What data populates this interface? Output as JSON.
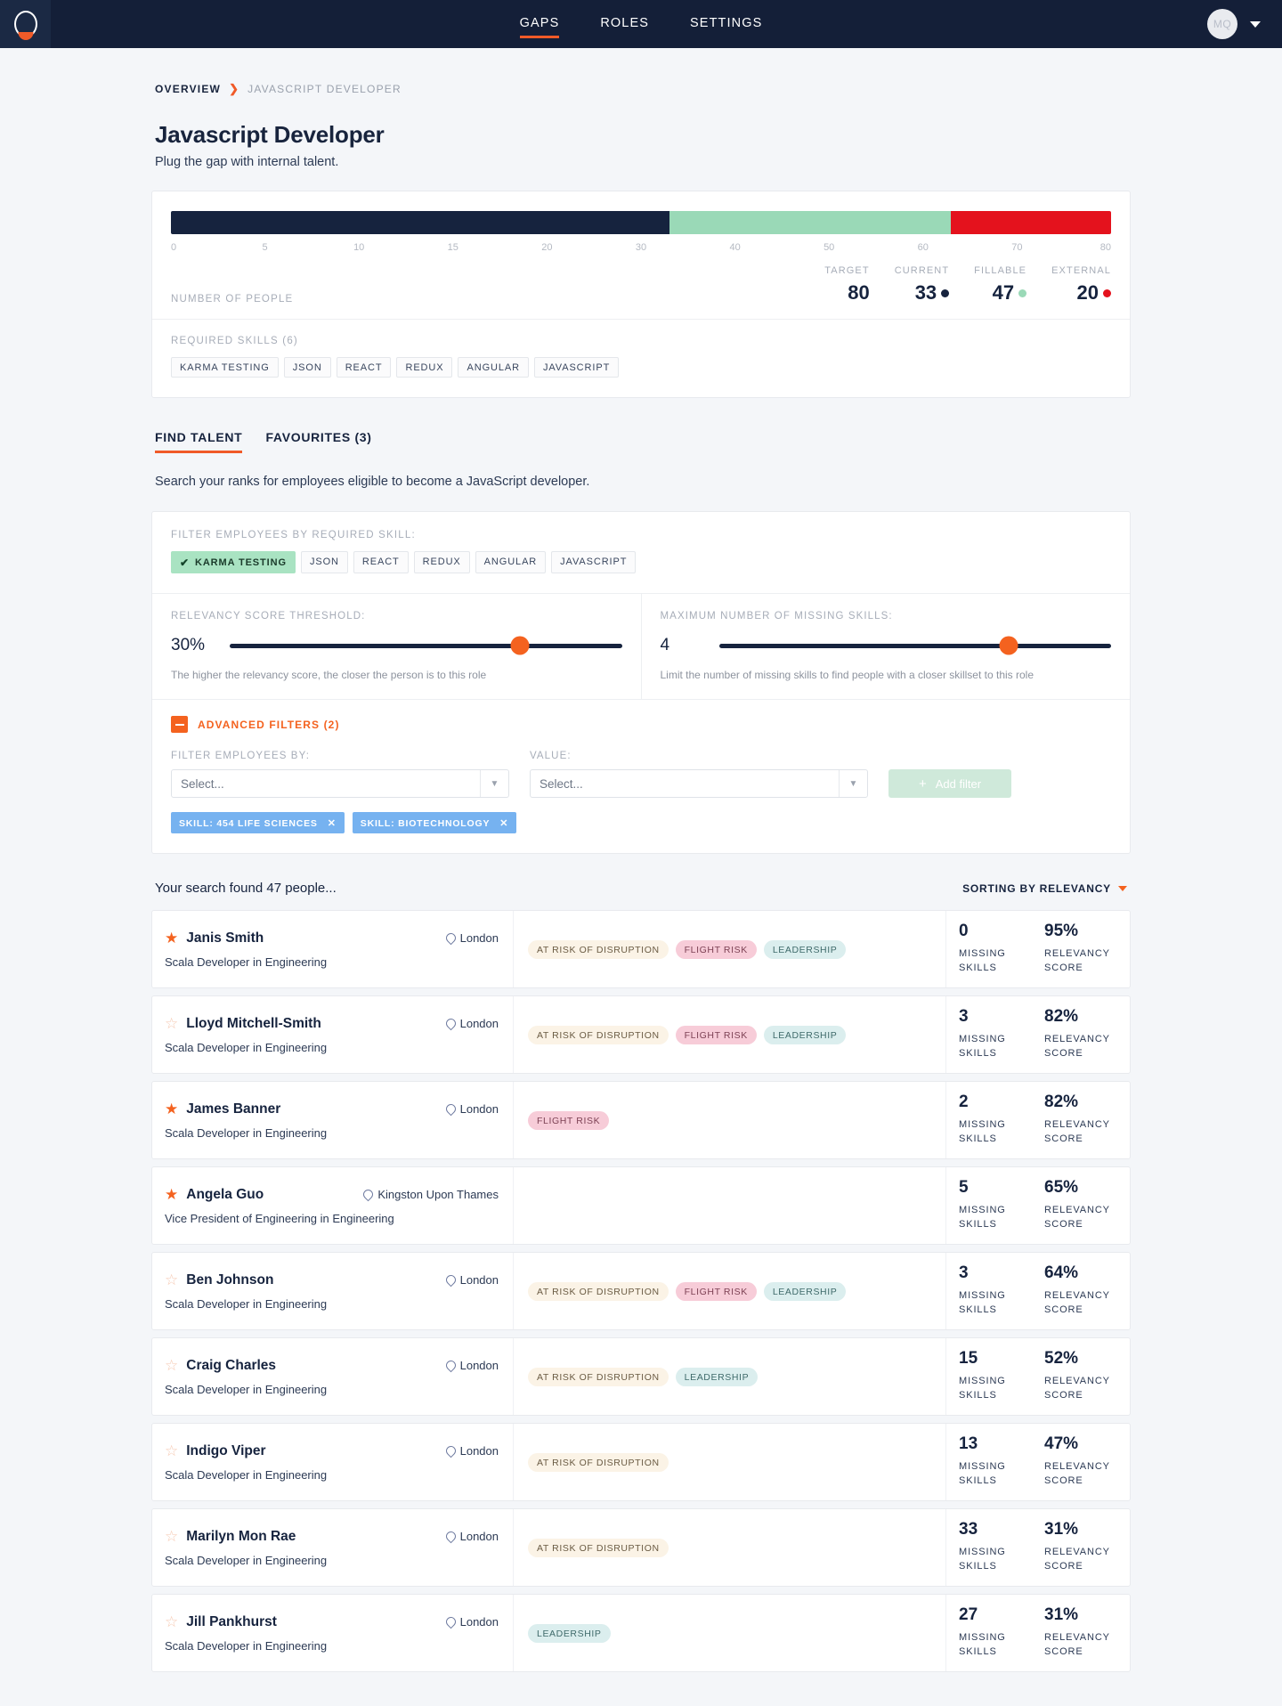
{
  "nav": {
    "logo": "logo-mark",
    "links": [
      {
        "label": "GAPS",
        "active": true
      },
      {
        "label": "ROLES",
        "active": false
      },
      {
        "label": "SETTINGS",
        "active": false
      }
    ],
    "avatar_initials": "MQ"
  },
  "breadcrumb": {
    "root": "OVERVIEW",
    "separator": "❯",
    "current": "JAVASCRIPT DEVELOPER"
  },
  "header": {
    "title": "Javascript Developer",
    "subtitle": "Plug the gap with internal talent."
  },
  "gauge": {
    "caption": "NUMBER OF PEOPLE",
    "ticks": [
      {
        "label": "0",
        "pos": 0
      },
      {
        "label": "5",
        "pos": 10
      },
      {
        "label": "10",
        "pos": 20
      },
      {
        "label": "15",
        "pos": 30
      },
      {
        "label": "20",
        "pos": 40
      },
      {
        "label": "30",
        "pos": 50
      },
      {
        "label": "40",
        "pos": 60
      },
      {
        "label": "50",
        "pos": 70
      },
      {
        "label": "60",
        "pos": 80
      },
      {
        "label": "70",
        "pos": 90
      },
      {
        "label": "80",
        "pos": 100
      }
    ],
    "segments": {
      "current_pct": 53,
      "fillable_pct": 30,
      "external_pct": 17
    },
    "stats": [
      {
        "label": "TARGET",
        "value": "80",
        "dot": "none"
      },
      {
        "label": "CURRENT",
        "value": "33",
        "dot": "current"
      },
      {
        "label": "FILLABLE",
        "value": "47",
        "dot": "fillable"
      },
      {
        "label": "EXTERNAL",
        "value": "20",
        "dot": "external"
      }
    ],
    "colors": {
      "current": "#16233e",
      "fillable": "#9ad9b7",
      "external": "#e4121d"
    }
  },
  "required_skills": {
    "caption": "REQUIRED SKILLS (6)",
    "items": [
      "KARMA TESTING",
      "JSON",
      "REACT",
      "REDUX",
      "ANGULAR",
      "JAVASCRIPT"
    ]
  },
  "tabs": [
    {
      "label": "FIND TALENT",
      "active": true
    },
    {
      "label": "FAVOURITES (3)",
      "active": false
    }
  ],
  "tab_description": "Search your ranks for employees eligible to become a JavaScript developer.",
  "filters": {
    "skill_caption": "FILTER EMPLOYEES BY REQUIRED SKILL:",
    "skill_chips": [
      {
        "label": "KARMA TESTING",
        "selected": true
      },
      {
        "label": "JSON",
        "selected": false
      },
      {
        "label": "REACT",
        "selected": false
      },
      {
        "label": "REDUX",
        "selected": false
      },
      {
        "label": "ANGULAR",
        "selected": false
      },
      {
        "label": "JAVASCRIPT",
        "selected": false
      }
    ],
    "relevancy": {
      "label": "RELEVANCY SCORE THRESHOLD:",
      "value": "30%",
      "thumb_pct": 74,
      "hint": "The higher the relevancy score, the closer the person is to this role"
    },
    "missing": {
      "label": "MAXIMUM NUMBER OF MISSING SKILLS:",
      "value": "4",
      "thumb_pct": 74,
      "hint": "Limit the number of missing skills to find people with a closer skillset to this role"
    },
    "advanced": {
      "title": "ADVANCED FILTERS (2)",
      "by_label": "FILTER EMPLOYEES BY:",
      "by_value": "Select...",
      "value_label": "VALUE:",
      "value_value": "Select...",
      "add_button": "Add filter",
      "tags": [
        {
          "label": "SKILL: 454 LIFE SCIENCES"
        },
        {
          "label": "SKILL: BIOTECHNOLOGY"
        }
      ]
    }
  },
  "results": {
    "count_text": "Your search found 47 people...",
    "sorting_label": "SORTING BY RELEVANCY",
    "metric_labels": {
      "missing": "MISSING SKILLS",
      "relevancy": "RELEVANCY SCORE"
    },
    "rows": [
      {
        "favourite": true,
        "name": "Janis Smith",
        "role": "Scala Developer in Engineering",
        "location": "London",
        "badges": [
          "AT RISK OF DISRUPTION",
          "FLIGHT RISK",
          "LEADERSHIP"
        ],
        "missing_skills": "0",
        "relevancy": "95%"
      },
      {
        "favourite": false,
        "name": "Lloyd Mitchell-Smith",
        "role": "Scala Developer in Engineering",
        "location": "London",
        "badges": [
          "AT RISK OF DISRUPTION",
          "FLIGHT RISK",
          "LEADERSHIP"
        ],
        "missing_skills": "3",
        "relevancy": "82%"
      },
      {
        "favourite": true,
        "name": "James Banner",
        "role": "Scala Developer in Engineering",
        "location": "London",
        "badges": [
          "FLIGHT RISK"
        ],
        "missing_skills": "2",
        "relevancy": "82%"
      },
      {
        "favourite": true,
        "name": "Angela Guo",
        "role": "Vice President of Engineering in Engineering",
        "location": "Kingston Upon Thames",
        "badges": [],
        "missing_skills": "5",
        "relevancy": "65%"
      },
      {
        "favourite": false,
        "name": "Ben Johnson",
        "role": "Scala Developer in Engineering",
        "location": "London",
        "badges": [
          "AT RISK OF DISRUPTION",
          "FLIGHT RISK",
          "LEADERSHIP"
        ],
        "missing_skills": "3",
        "relevancy": "64%"
      },
      {
        "favourite": false,
        "name": "Craig Charles",
        "role": "Scala Developer in Engineering",
        "location": "London",
        "badges": [
          "AT RISK OF DISRUPTION",
          "LEADERSHIP"
        ],
        "missing_skills": "15",
        "relevancy": "52%"
      },
      {
        "favourite": false,
        "name": "Indigo Viper",
        "role": "Scala Developer in Engineering",
        "location": "London",
        "badges": [
          "AT RISK OF DISRUPTION"
        ],
        "missing_skills": "13",
        "relevancy": "47%"
      },
      {
        "favourite": false,
        "name": "Marilyn Mon Rae",
        "role": "Scala Developer in Engineering",
        "location": "London",
        "badges": [
          "AT RISK OF DISRUPTION"
        ],
        "missing_skills": "33",
        "relevancy": "31%"
      },
      {
        "favourite": false,
        "name": "Jill Pankhurst",
        "role": "Scala Developer in Engineering",
        "location": "London",
        "badges": [
          "LEADERSHIP"
        ],
        "missing_skills": "27",
        "relevancy": "31%"
      }
    ]
  }
}
